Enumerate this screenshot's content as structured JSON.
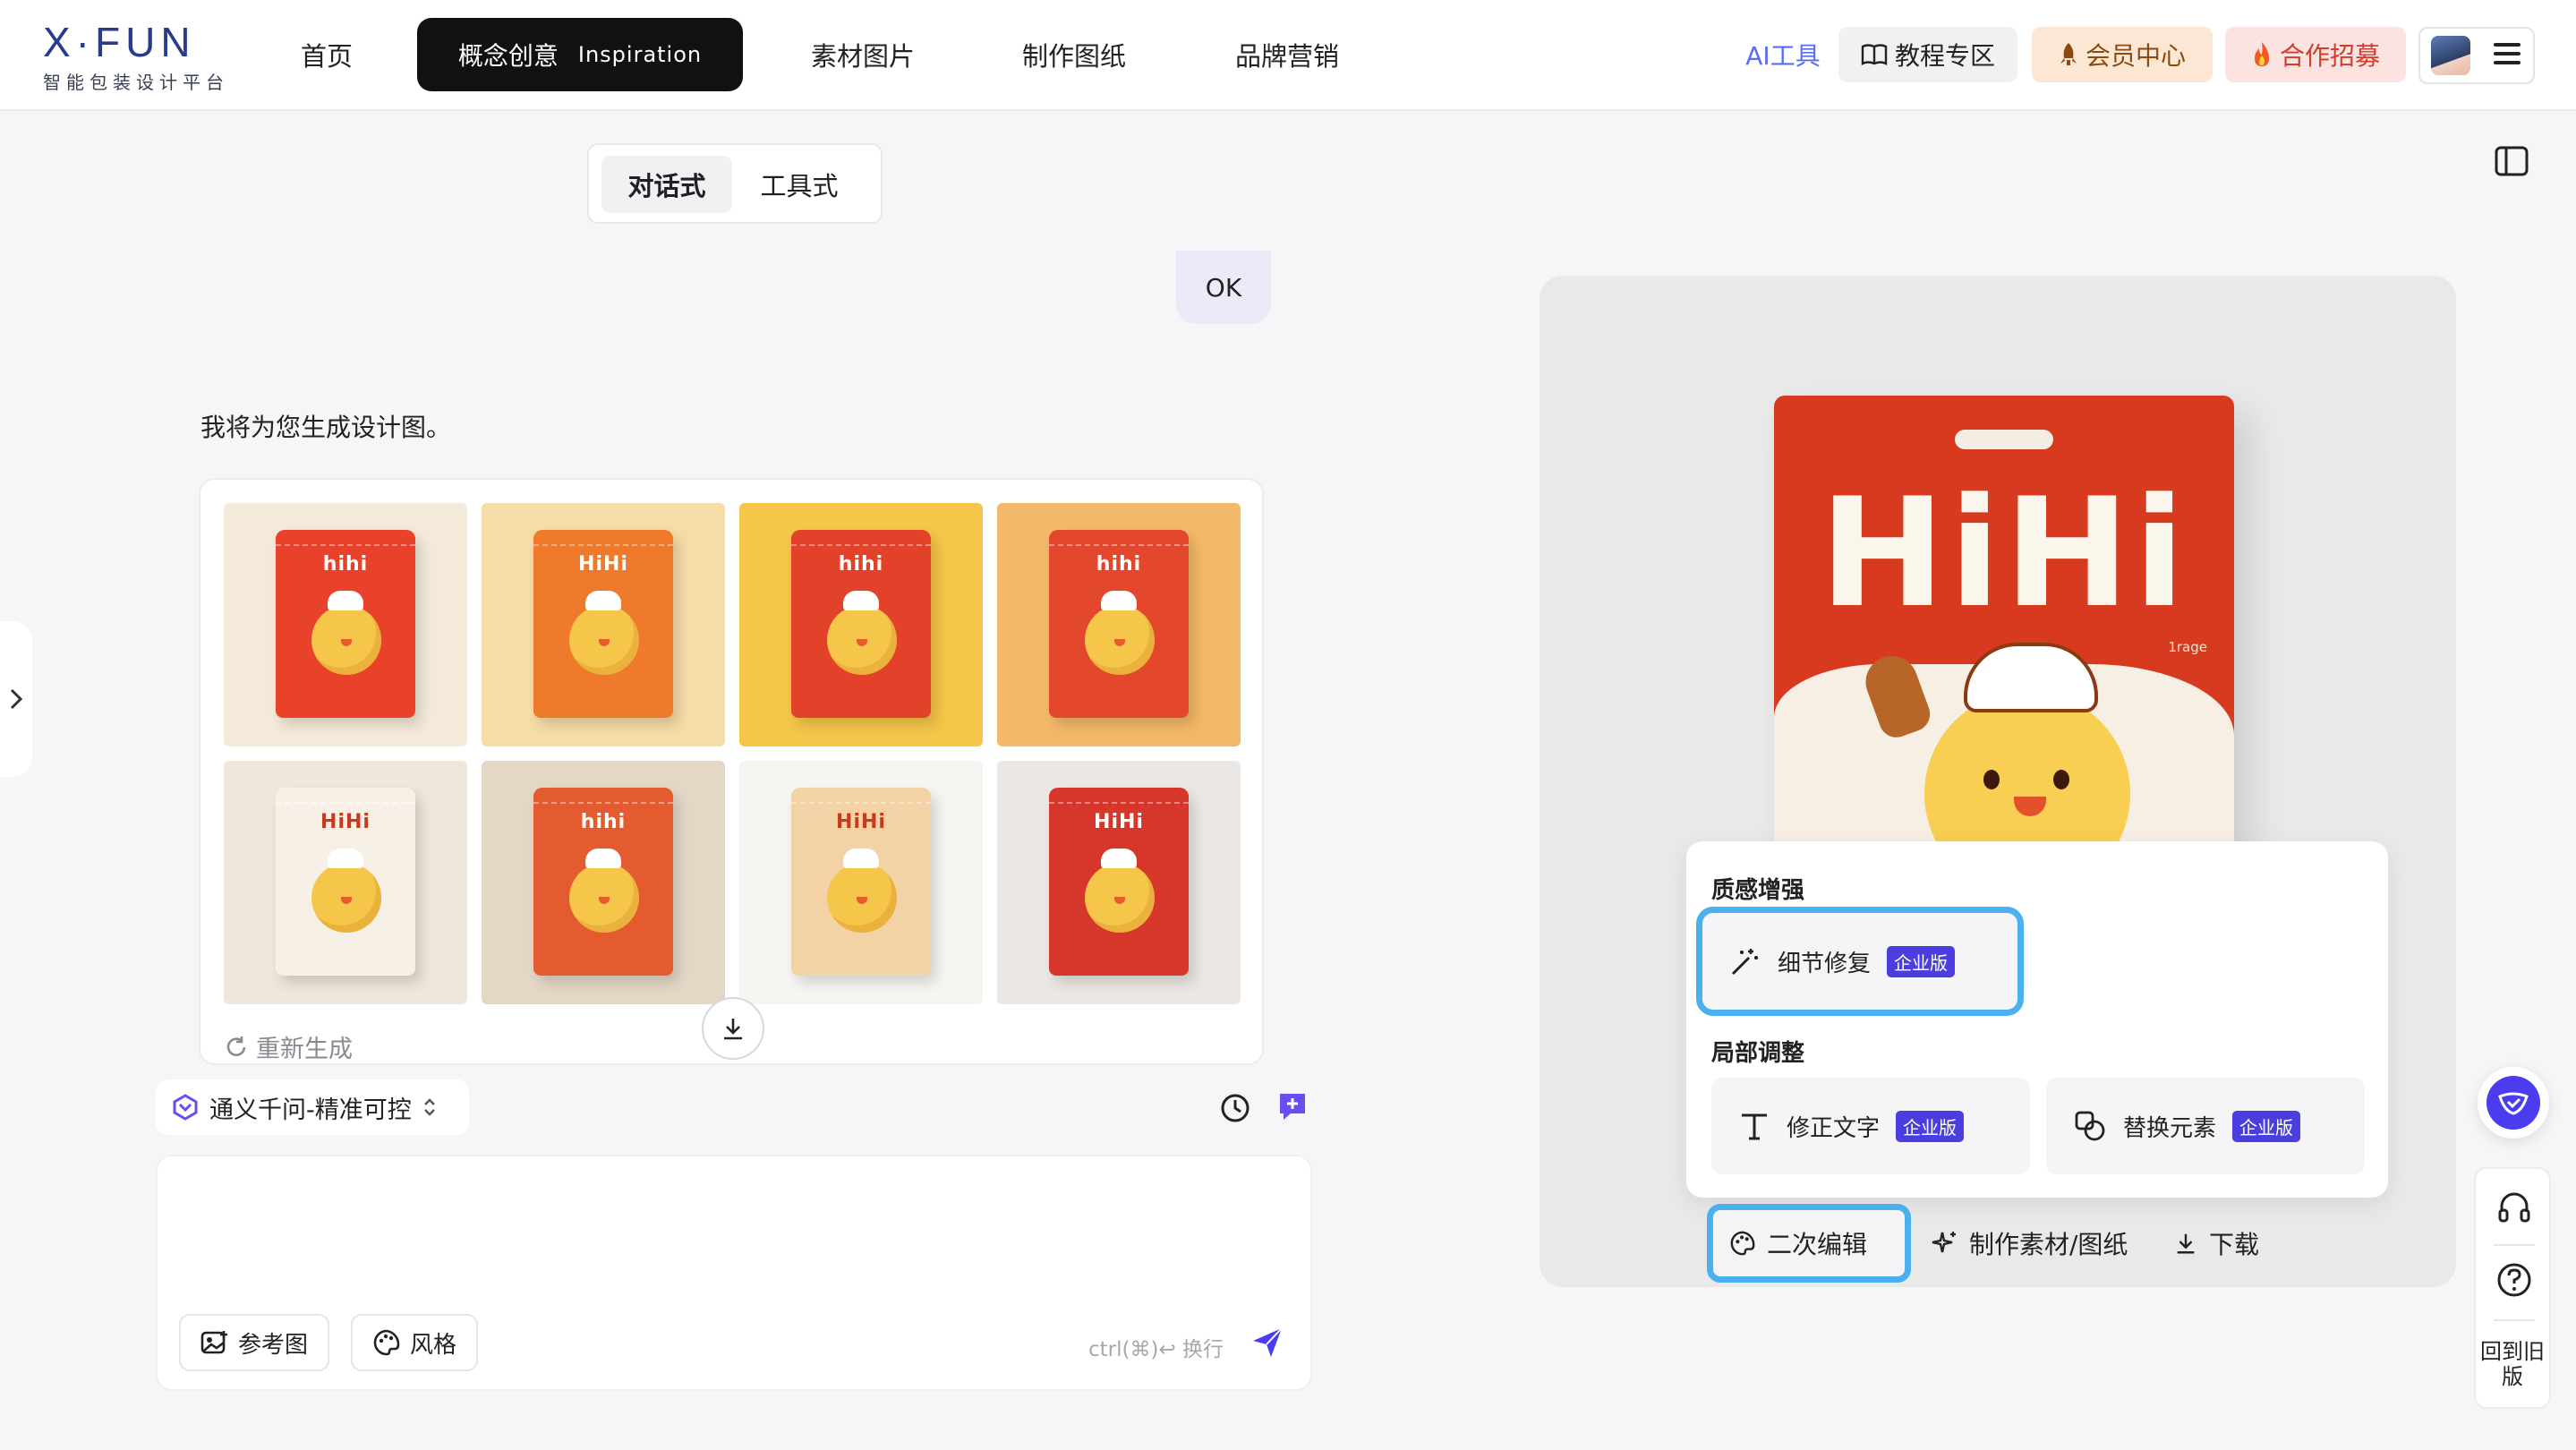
{
  "brand": {
    "logo": "X·FUN",
    "tagline": "智能包装设计平台"
  },
  "nav": {
    "home": "首页",
    "concept": "概念创意",
    "concept_en": "Inspiration",
    "materials": "素材图片",
    "drawings": "制作图纸",
    "marketing": "品牌营销"
  },
  "header_actions": {
    "ai_tools": "AI工具",
    "tutorial": "教程专区",
    "member": "会员中心",
    "partner": "合作招募"
  },
  "mode": {
    "chat": "对话式",
    "tool": "工具式"
  },
  "chat": {
    "user_message": "OK",
    "assistant_message": "我将为您生成设计图。",
    "regenerate": "重新生成",
    "thumbnails": [
      {
        "brand": "hihi",
        "bg": "#f4ead9",
        "bag": "#e8432a"
      },
      {
        "brand": "HiHi",
        "bg": "#f6dca6",
        "bag": "#ef7a2b"
      },
      {
        "brand": "hihi",
        "bg": "#f6c64a",
        "bag": "#e2412a"
      },
      {
        "brand": "hihi",
        "bg": "#f3b968",
        "bag": "#e4482c"
      },
      {
        "brand": "HiHi",
        "bg": "#efe7db",
        "bag": "#f7f0e6"
      },
      {
        "brand": "hihi",
        "bg": "#e5d7c6",
        "bag": "#e35b2f"
      },
      {
        "brand": "HiHi",
        "bg": "#f7f5f2",
        "bag": "#f3d2a6"
      },
      {
        "brand": "HiHi",
        "bg": "#ebe7e4",
        "bag": "#d7362a"
      }
    ]
  },
  "composer": {
    "model": "通义千问-精准可控",
    "reference": "参考图",
    "style": "风格",
    "hint": "ctrl(⌘)↩ 换行"
  },
  "preview": {
    "product_brand": "HiHi",
    "product_sub": "1rage",
    "sections": {
      "texture": "质感增强",
      "local": "局部调整"
    },
    "tools": {
      "detail_fix": "细节修复",
      "fix_text": "修正文字",
      "replace_element": "替换元素",
      "badge": "企业版"
    },
    "actions": {
      "second_edit": "二次编辑",
      "make_assets": "制作素材/图纸",
      "download": "下载"
    }
  },
  "side": {
    "old_version": "回到旧版"
  }
}
